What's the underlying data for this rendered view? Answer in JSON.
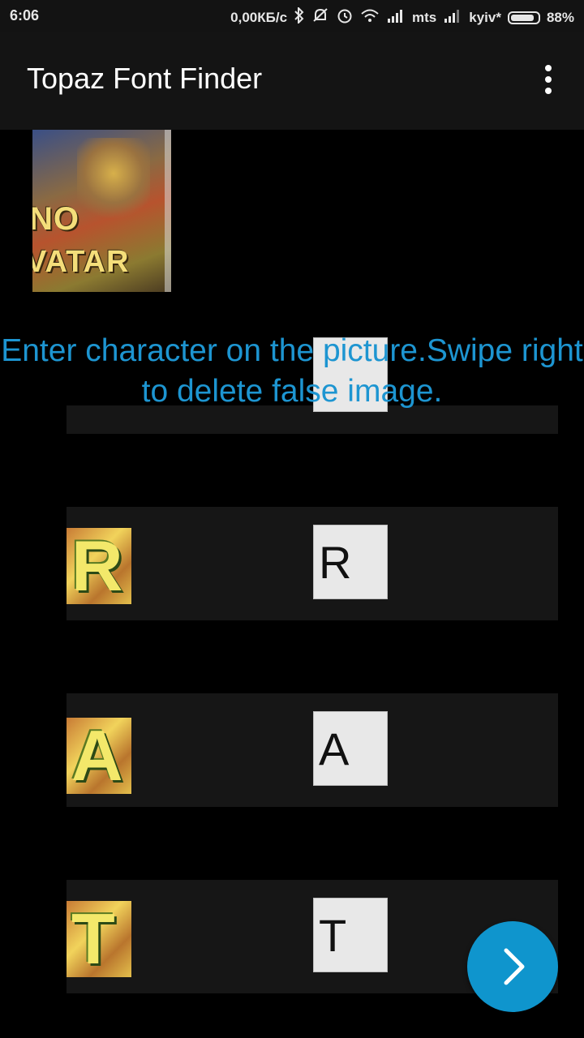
{
  "status_bar": {
    "time": "6:06",
    "speed": "0,00КБ/с",
    "carrier1": "mts",
    "carrier2": "kyiv*",
    "battery": "88%",
    "battery_level": 0.88
  },
  "app_bar": {
    "title": "Topaz Font Finder"
  },
  "preview": {
    "line1": "NO",
    "line2": "VATAR"
  },
  "instruction": "Enter character on the picture.Swipe right to delete false image.",
  "rows": [
    {
      "value": ""
    },
    {
      "thumb_char": "R",
      "value": "R"
    },
    {
      "thumb_char": "A",
      "value": "A"
    },
    {
      "thumb_char": "T",
      "value": "T"
    }
  ],
  "colors": {
    "accent": "#1d95d1",
    "fab": "#0f95cd",
    "app_bar": "#141414",
    "row": "#161616"
  }
}
